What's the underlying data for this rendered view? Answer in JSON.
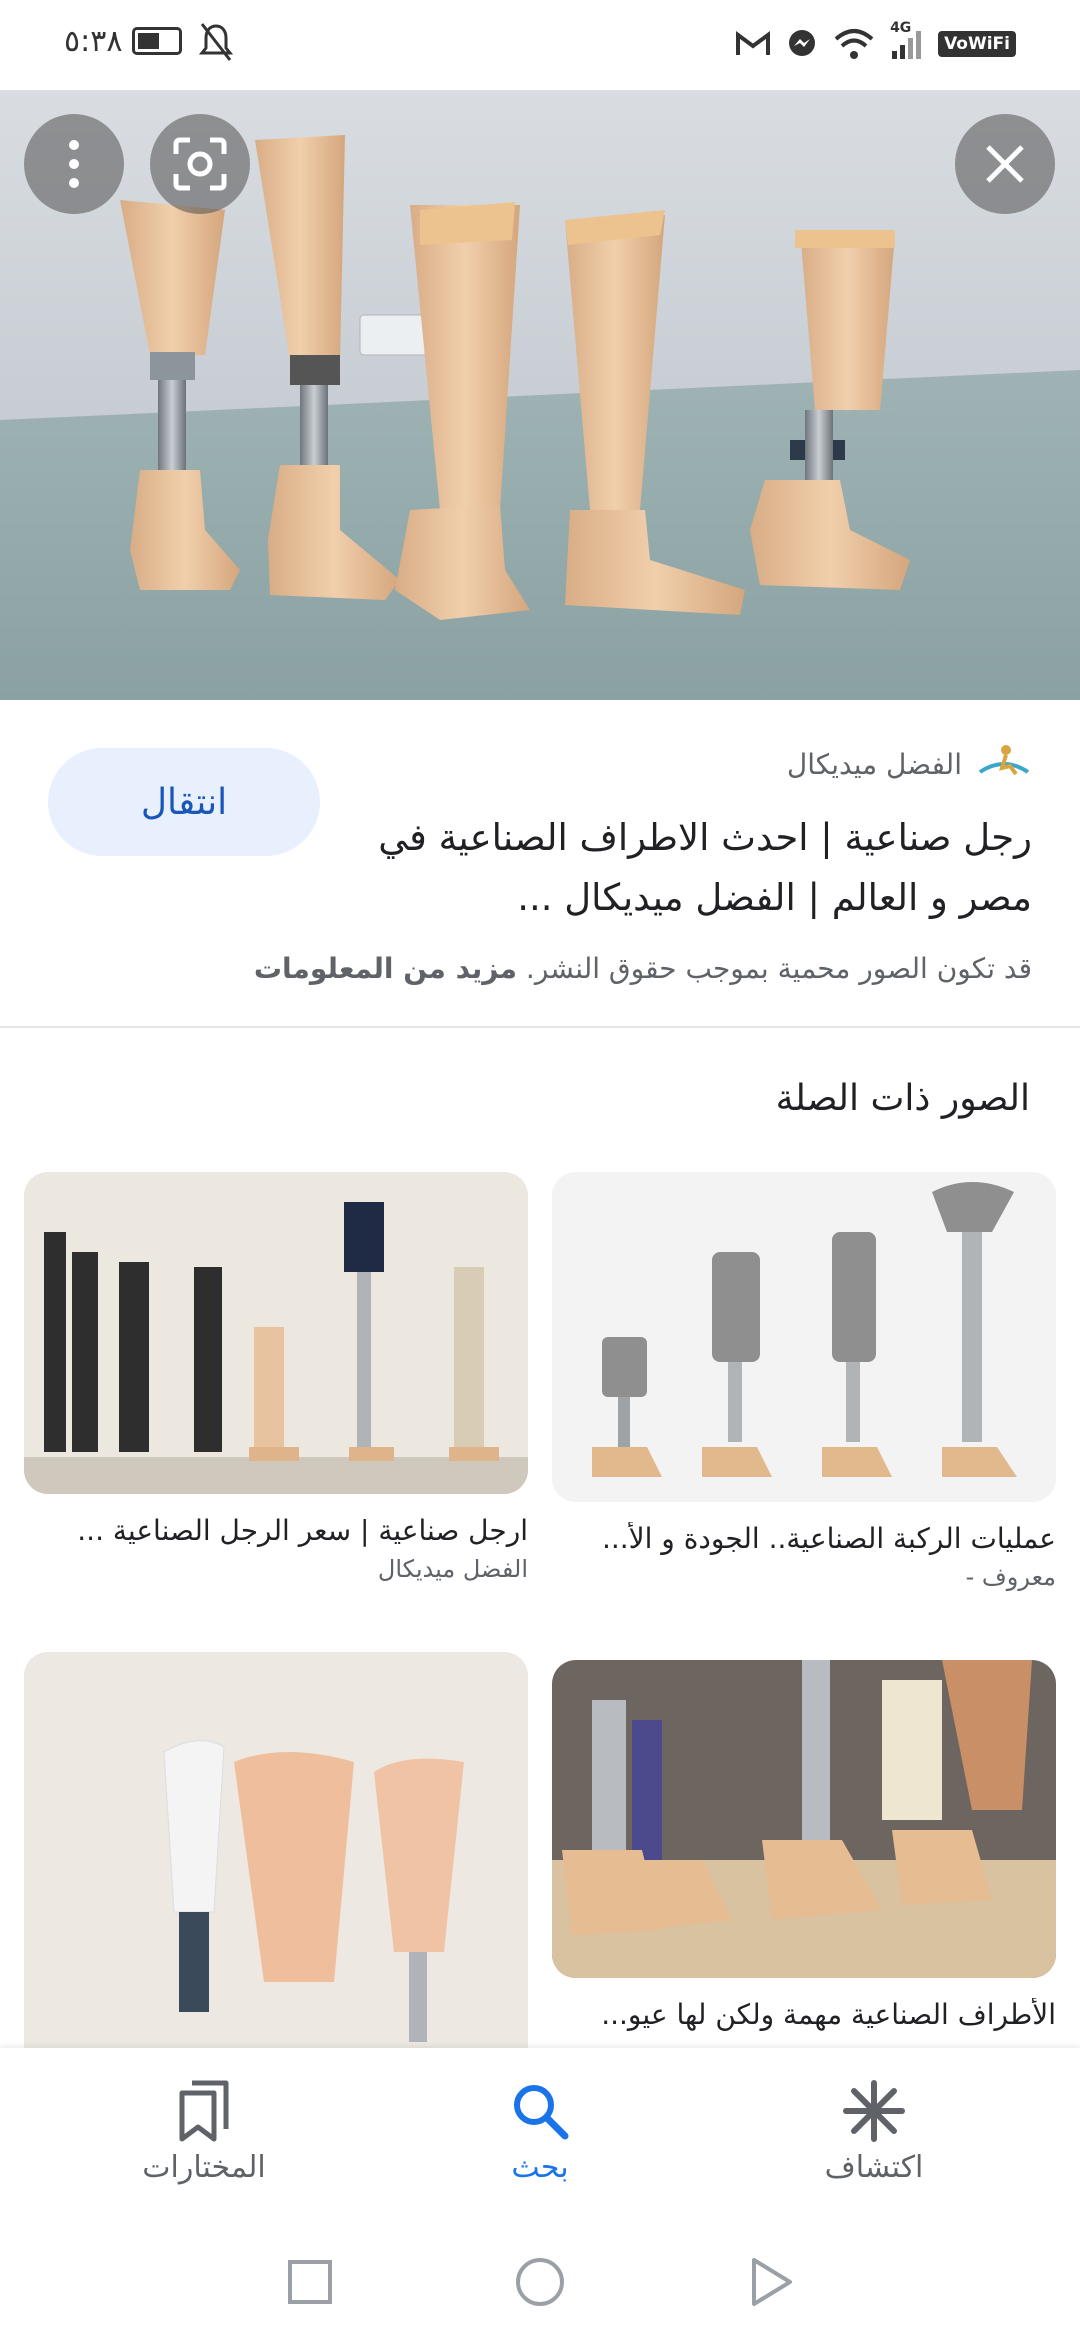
{
  "status_bar": {
    "time": "٥:٣٨",
    "network": "4G",
    "vowifi_label": "VoWiFi",
    "battery_level": 0.55,
    "icons": [
      "battery-icon",
      "mute-icon",
      "gmail-icon",
      "messenger-icon",
      "wifi-icon",
      "signal-icon"
    ]
  },
  "viewer": {
    "close_icon": "close-icon",
    "lens_icon": "google-lens-icon",
    "more_icon": "more-vert-icon"
  },
  "result": {
    "source_name": "الفضل ميديكال",
    "title": "رجل صناعية | احدث الاطراف الصناعية في مصر و العالم | الفضل ميديكال ...",
    "visit_label": "انتقال",
    "copyright_notice": "قد تكون الصور محمية بموجب حقوق النشر.",
    "more_info_label": "مزيد من المعلومات"
  },
  "related": {
    "heading": "الصور ذات الصلة",
    "items": [
      {
        "caption": "عمليات الركبة الصناعية.. الجودة و الأ...",
        "source": "معروف -"
      },
      {
        "caption": "ارجل صناعية | سعر الرجل الصناعية ...",
        "source": "الفضل ميديكال"
      },
      {
        "caption": "الأطراف الصناعية مهمة ولكن لها عيو...",
        "source": ""
      },
      {
        "caption": "",
        "source": ""
      }
    ]
  },
  "bottom_nav": {
    "items": [
      {
        "label": "المختارات",
        "icon": "bookmarks-icon",
        "active": false
      },
      {
        "label": "بحث",
        "icon": "search-icon",
        "active": true
      },
      {
        "label": "اكتشاف",
        "icon": "discover-asterisk-icon",
        "active": false
      }
    ]
  },
  "colors": {
    "accent": "#1a73e8",
    "visit_button_bg": "#e8f0fe",
    "visit_button_text": "#1a56b8"
  }
}
